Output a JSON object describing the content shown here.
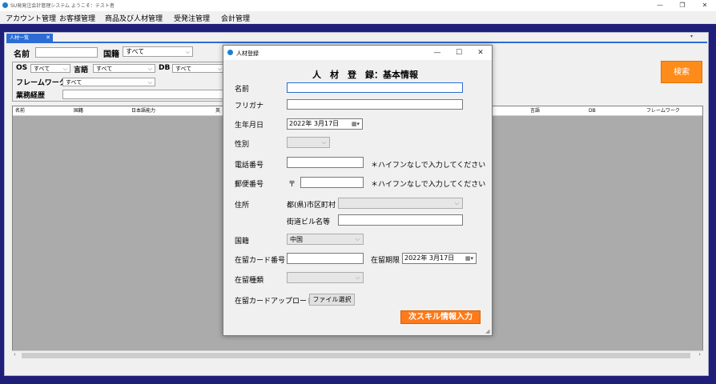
{
  "window": {
    "title": "SU発発注会計管理システム ようこそ：テスト者",
    "minimize": "—",
    "restore": "❐",
    "close": "✕"
  },
  "menu": [
    "アカウント管理",
    "お客様管理",
    "商品及び人材管理",
    "受発注管理",
    "会計管理"
  ],
  "tab": {
    "label": "人材一覧",
    "close": "✕"
  },
  "filters": {
    "name_label": "名前",
    "country_label": "国籍",
    "country_value": "すべて",
    "os_label": "OS",
    "os_value": "すべて",
    "lang_label": "言語",
    "lang_value": "すべて",
    "db_label": "DB",
    "db_value": "すべて",
    "framework_label": "フレームワーク",
    "framework_value": "すべて",
    "history_label": "業務経歴",
    "search_button": "検索"
  },
  "grid": {
    "columns": [
      "名前",
      "国籍",
      "日本語能力",
      "英",
      "言語",
      "DB",
      "フレームワーク"
    ]
  },
  "dialog": {
    "title": "人材登録",
    "heading": "人　材　登　録：基本情報",
    "name_label": "名前",
    "furigana_label": "フリガナ",
    "birthday_label": "生年月日",
    "birthday_value": "2022年  3月17日",
    "gender_label": "性別",
    "phone_label": "電話番号",
    "phone_note": "＊ハイフンなしで入力してください",
    "postal_label": "郵便番号",
    "postal_mark": "〒",
    "postal_note": "＊ハイフンなしで入力してください",
    "address_label": "住所",
    "prefecture_label": "都(県)市区町村",
    "street_label": "街道ビル名等",
    "nationality_label": "国籍",
    "nationality_value": "中国",
    "residence_card_label": "在留カード番号",
    "residence_period_label": "在留期限",
    "residence_period_value": "2022年  3月17日",
    "residence_type_label": "在留種類",
    "upload_label": "在留カードアップロード",
    "file_button": "ファイル選択",
    "next_button": "次スキル情報入力"
  },
  "colors": {
    "accent_orange": "#ff8c1a",
    "tab_blue": "#2b6cd6",
    "background_navy": "#1f1f7a"
  }
}
